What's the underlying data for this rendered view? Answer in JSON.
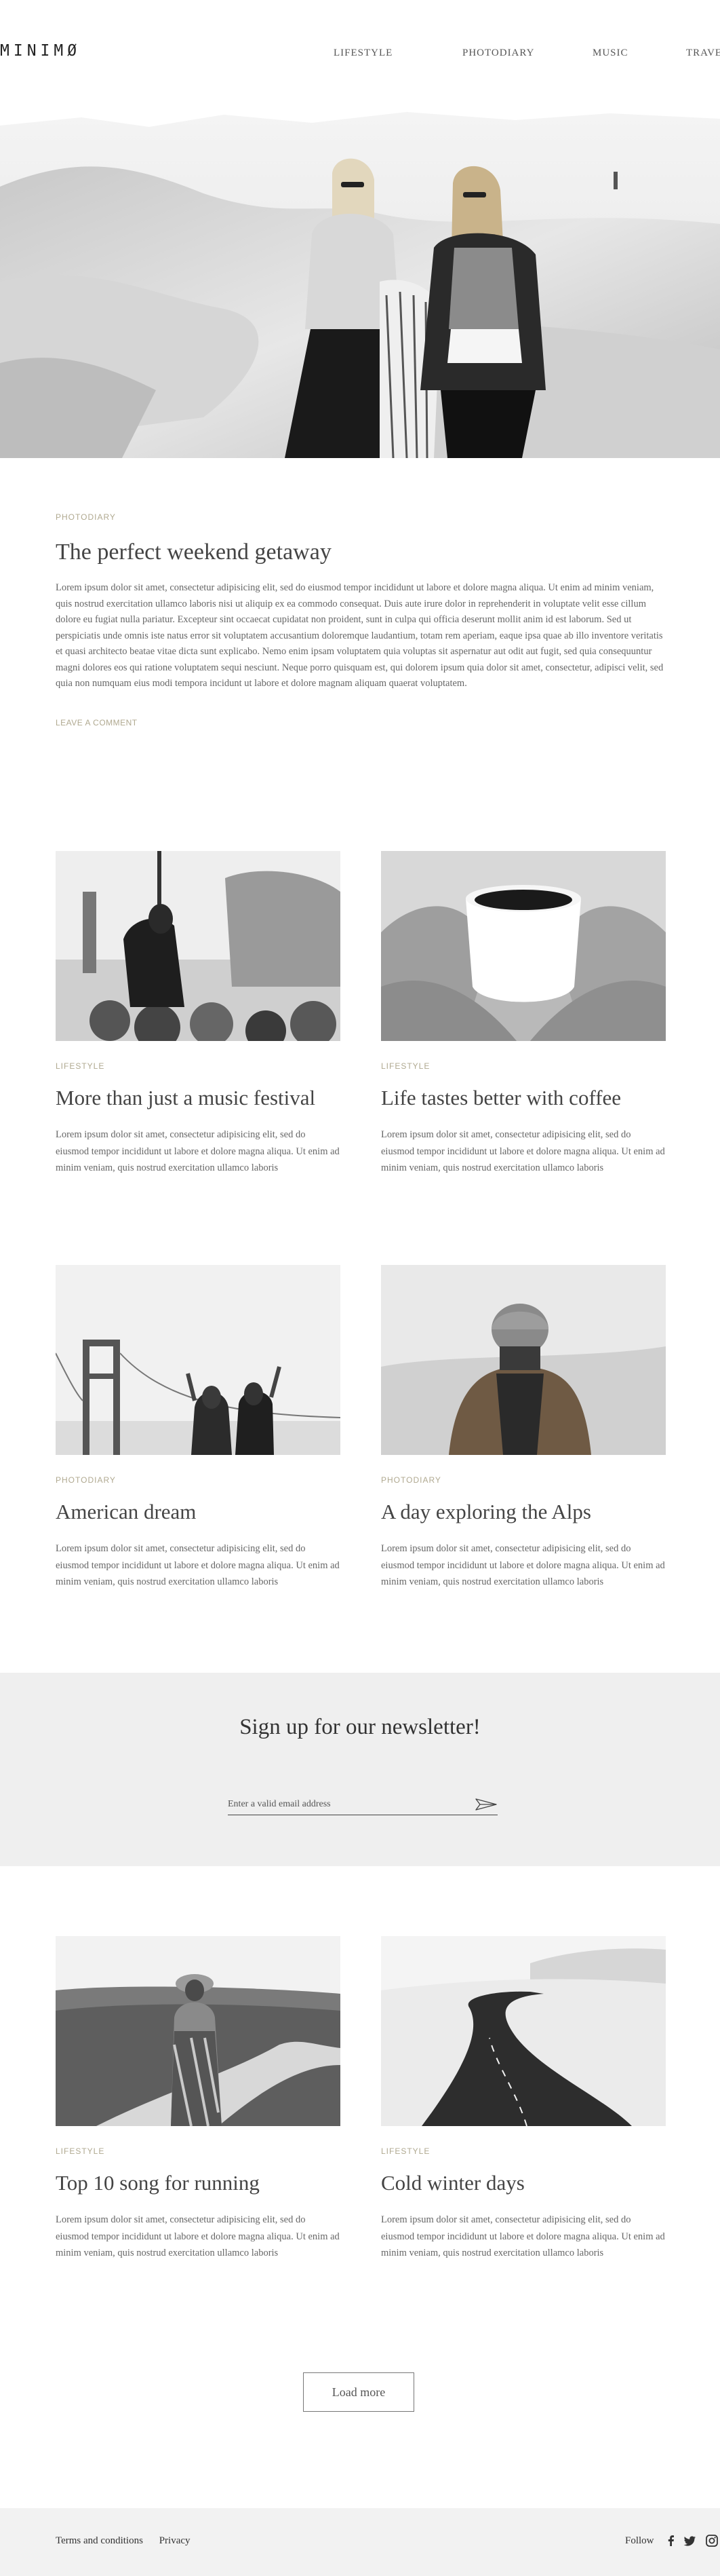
{
  "brand": {
    "logo": "MINIMØ"
  },
  "nav": {
    "items": [
      "LIFESTYLE",
      "PHOTODIARY",
      "MUSIC",
      "TRAVEL"
    ]
  },
  "featured": {
    "category": "PHOTODIARY",
    "title": "The perfect weekend getaway",
    "body": "Lorem ipsum dolor sit amet, consectetur adipisicing elit, sed do eiusmod tempor incididunt ut labore et dolore magna aliqua. Ut enim ad minim veniam, quis nostrud exercitation ullamco laboris nisi ut aliquip ex ea commodo consequat. Duis aute irure dolor in reprehenderit in voluptate velit esse cillum dolore eu fugiat nulla pariatur. Excepteur sint occaecat cupidatat non proident, sunt in culpa qui officia deserunt mollit anim id est laborum. Sed ut perspiciatis unde omnis iste natus error sit voluptatem accusantium doloremque laudantium, totam rem aperiam, eaque ipsa quae ab illo inventore veritatis et quasi architecto beatae vitae dicta sunt explicabo. Nemo enim ipsam voluptatem quia voluptas sit aspernatur aut odit aut fugit, sed quia consequuntur magni dolores eos qui ratione voluptatem sequi nesciunt. Neque porro quisquam est, qui dolorem ipsum quia dolor sit amet, consectetur, adipisci velit, sed quia non numquam eius modi tempora incidunt ut labore et dolore magnam aliquam quaerat voluptatem.",
    "comment_link": "LEAVE A COMMENT"
  },
  "posts": [
    {
      "category": "LIFESTYLE",
      "title": "More than just a music festival",
      "excerpt": "Lorem ipsum dolor sit amet, consectetur adipisicing elit, sed do eiusmod tempor incididunt ut labore et dolore magna aliqua. Ut enim ad minim veniam, quis nostrud exercitation ullamco laboris"
    },
    {
      "category": "LIFESTYLE",
      "title": "Life tastes better with coffee",
      "excerpt": "Lorem ipsum dolor sit amet, consectetur adipisicing elit, sed do eiusmod tempor incididunt ut labore et dolore magna aliqua. Ut enim ad minim veniam, quis nostrud exercitation ullamco laboris"
    },
    {
      "category": "PHOTODIARY",
      "title": "American dream",
      "excerpt": "Lorem ipsum dolor sit amet, consectetur adipisicing elit, sed do eiusmod tempor incididunt ut labore et dolore magna aliqua. Ut enim ad minim veniam, quis nostrud exercitation ullamco laboris"
    },
    {
      "category": "PHOTODIARY",
      "title": "A day exploring the Alps",
      "excerpt": "Lorem ipsum dolor sit amet, consectetur adipisicing elit, sed do eiusmod tempor incididunt ut labore et dolore magna aliqua. Ut enim ad minim veniam, quis nostrud exercitation ullamco laboris"
    },
    {
      "category": "LIFESTYLE",
      "title": "Top 10 song for running",
      "excerpt": "Lorem ipsum dolor sit amet, consectetur adipisicing elit, sed do eiusmod tempor incididunt ut labore et dolore magna aliqua. Ut enim ad minim veniam, quis nostrud exercitation ullamco laboris"
    },
    {
      "category": "LIFESTYLE",
      "title": "Cold winter days",
      "excerpt": "Lorem ipsum dolor sit amet, consectetur adipisicing elit, sed do eiusmod tempor incididunt ut labore et dolore magna aliqua. Ut enim ad minim veniam, quis nostrud exercitation ullamco laboris"
    }
  ],
  "newsletter": {
    "heading": "Sign up for our newsletter!",
    "placeholder": "Enter a valid email address",
    "send_icon": "paper-plane-icon"
  },
  "load_more": "Load more",
  "footer": {
    "links": [
      "Terms and conditions",
      "Privacy"
    ],
    "follow": "Follow",
    "social_icons": [
      "facebook-icon",
      "twitter-icon",
      "instagram-icon"
    ]
  }
}
